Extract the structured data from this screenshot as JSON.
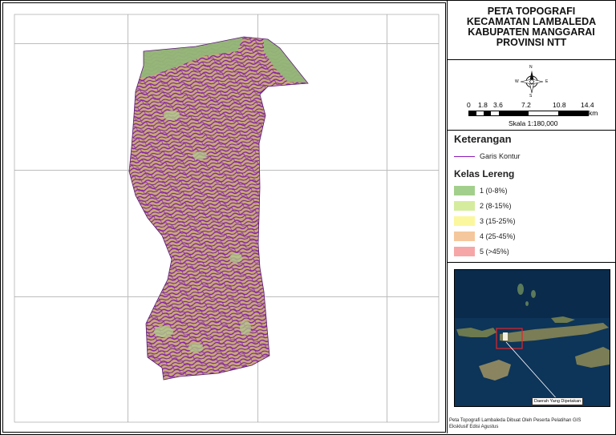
{
  "title": {
    "line1": "PETA TOPOGRAFI",
    "line2": "KECAMATAN LAMBALEDA",
    "line3": "KABUPATEN MANGGARAI",
    "line4": "PROVINSI NTT"
  },
  "compass": {
    "n": "N",
    "w": "W",
    "e": "E",
    "s": "S",
    "icon": "north-arrow-compass"
  },
  "scalebar": {
    "ticks": [
      "0",
      "1.8",
      "3.6",
      "7.2",
      "10.8",
      "14.4"
    ],
    "unit": "km",
    "scale_text": "Skala 1:180,000"
  },
  "legend": {
    "heading": "Keterangan",
    "contour_label": "Garis Kontur",
    "contour_color": "#8b1ab8",
    "slope_heading": "Kelas Lereng",
    "classes": [
      {
        "label": "1 (0-8%)",
        "color": "#a3cf8c"
      },
      {
        "label": "2 (8-15%)",
        "color": "#d5ec9e"
      },
      {
        "label": "3 (15-25%)",
        "color": "#fbf79e"
      },
      {
        "label": "4 (25-45%)",
        "color": "#f5c79d"
      },
      {
        "label": "5 (>45%)",
        "color": "#f6a6a6"
      }
    ]
  },
  "inset": {
    "label": "Daerah Yang Dipetakan",
    "sea_color": "#0c2f52",
    "highlight_color": "#e0262b"
  },
  "credit": {
    "line1": "Peta Topografi Lambaleda Dibuat Oleh Peserta Pelatihan GIS",
    "line2": "Eksklusif Edisi Agustus"
  }
}
